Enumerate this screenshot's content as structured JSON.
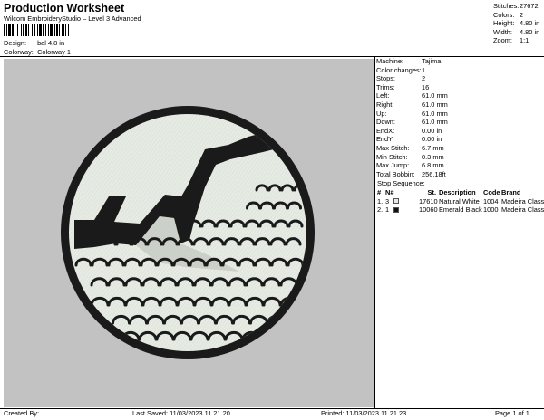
{
  "header": {
    "title": "Production Worksheet",
    "subtitle": "Wilcom EmbroideryStudio – Level 3 Advanced",
    "design_label": "Design:",
    "design_value": "bal 4,8 in",
    "colorway_label": "Colorway:",
    "colorway_value": "Colorway 1"
  },
  "stats": [
    {
      "label": "Stitches:",
      "value": "27672"
    },
    {
      "label": "Colors:",
      "value": "2"
    },
    {
      "label": "Height:",
      "value": "4.80 in"
    },
    {
      "label": "Width:",
      "value": "4.80 in"
    },
    {
      "label": "Zoom:",
      "value": "1:1"
    }
  ],
  "machine_info": [
    {
      "label": "Machine:",
      "value": "Tajima"
    },
    {
      "label": "Color changes:",
      "value": "1"
    },
    {
      "label": "Stops:",
      "value": "2"
    },
    {
      "label": "Trims:",
      "value": "16"
    },
    {
      "label": "Left:",
      "value": "61.0 mm"
    },
    {
      "label": "Right:",
      "value": "61.0 mm"
    },
    {
      "label": "Up:",
      "value": "61.0 mm"
    },
    {
      "label": "Down:",
      "value": "61.0 mm"
    },
    {
      "label": "EndX:",
      "value": "0.00 in"
    },
    {
      "label": "EndY:",
      "value": "0.00 in"
    },
    {
      "label": "Max Stitch:",
      "value": "6.7 mm"
    },
    {
      "label": "Min Stitch:",
      "value": "0.3 mm"
    },
    {
      "label": "Max Jump:",
      "value": "6.8 mm"
    },
    {
      "label": "Total Bobbin:",
      "value": "256.18ft"
    }
  ],
  "stop_sequence": {
    "title": "Stop Sequence:",
    "headers": [
      "#",
      "N#",
      "St.",
      "Description",
      "Code",
      "Brand"
    ],
    "rows": [
      {
        "index": "1.",
        "num": "3",
        "color": "#e8ece6",
        "stitches": "17610",
        "description": "Natural White",
        "code": "1004",
        "brand": "Madeira Classic 40"
      },
      {
        "index": "2.",
        "num": "1",
        "color": "#111111",
        "stitches": "10060",
        "description": "Emerald Black",
        "code": "1000",
        "brand": "Madeira Classic 40"
      }
    ]
  },
  "footer": {
    "created_by": "Created By:",
    "last_saved": "Last Saved: 11/03/2023 11.21.20",
    "printed": "Printed: 11/03/2023 11.21.23",
    "page": "Page 1 of 1"
  },
  "colors": {
    "canvas_bg": "#c2c2c2",
    "fabric_white": "#e8ece6",
    "thread_black": "#1a1a1a"
  }
}
